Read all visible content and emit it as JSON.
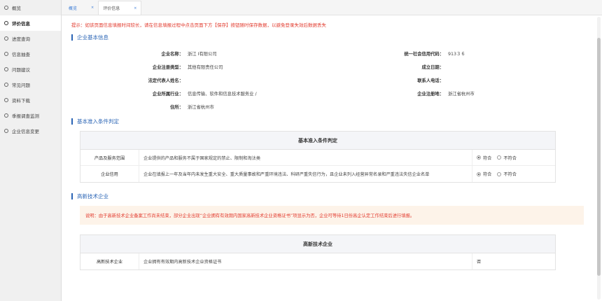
{
  "sidebar": {
    "items": [
      {
        "label": "概览"
      },
      {
        "label": "评价信息"
      },
      {
        "label": "进度查询"
      },
      {
        "label": "信息抽查"
      },
      {
        "label": "问题建议"
      },
      {
        "label": "常见问题"
      },
      {
        "label": "资料下载"
      },
      {
        "label": "季报调查监测"
      },
      {
        "label": "企业信息变更"
      }
    ],
    "active_index": 1
  },
  "tabs": [
    {
      "label": "概览",
      "close": "×"
    },
    {
      "label": "评价信息",
      "close": "×"
    }
  ],
  "notice": "提示：如该页面信息填报时间较长，请在信息填报过程中点击页面下方【保存】按钮随时保存数据，以避免登录失效后数据丢失",
  "section_basic": {
    "title": "企业基本信息",
    "rows": [
      {
        "k1": "企业名称：",
        "v1": "浙江                  I有限公司",
        "k2": "统一社会信用代码：",
        "v2": "913３６"
      },
      {
        "k1": "企业注册类型：",
        "v1": "其他有限责任公司",
        "k2": "成立日期：",
        "v2": ""
      },
      {
        "k1": "法定代表人姓名：",
        "v1": "",
        "k2": "联系人电话：",
        "v2": ""
      },
      {
        "k1": "企业所属行业：",
        "v1": "信息传输、软件和信息技术服务业 /",
        "k2": "企业注册地：",
        "v2": "浙江省杭州市"
      },
      {
        "k1": "住所：",
        "v1": "浙江省杭州市",
        "k2": "",
        "v2": ""
      }
    ]
  },
  "section_criteria": {
    "title": "基本准入条件判定",
    "table_head": "基本准入条件判定",
    "rows": [
      {
        "name": "产品及服务范围",
        "desc": "企业提供的产品和服务不属于国家规定的禁止、限制和淘汰类",
        "yes": "符合",
        "no": "不符合",
        "selected": "yes"
      },
      {
        "name": "企业信用",
        "desc": "企业在填报上一年及当年内未发生重大安全、重大质量事故和严重环境违法、科研严重失信行为，且企业未列入经营异常名录和严重违法失信企业名单",
        "yes": "符合",
        "no": "不符合",
        "selected": "yes"
      }
    ]
  },
  "section_hightech": {
    "title": "高新技术企业",
    "explain": "说明：由于高新技术企业备案工作尚未结束，部分企业出现“企业拥有有效期内国家高新技术企业资格证书”项显示为否，企业可等待1日份高企认定工作结束后进行填报。",
    "table_head": "高新技术企业",
    "rows": [
      {
        "name": "高新技术企业",
        "desc": "企业拥有有效期内高新技术企业资格证书",
        "value": "否"
      }
    ]
  }
}
